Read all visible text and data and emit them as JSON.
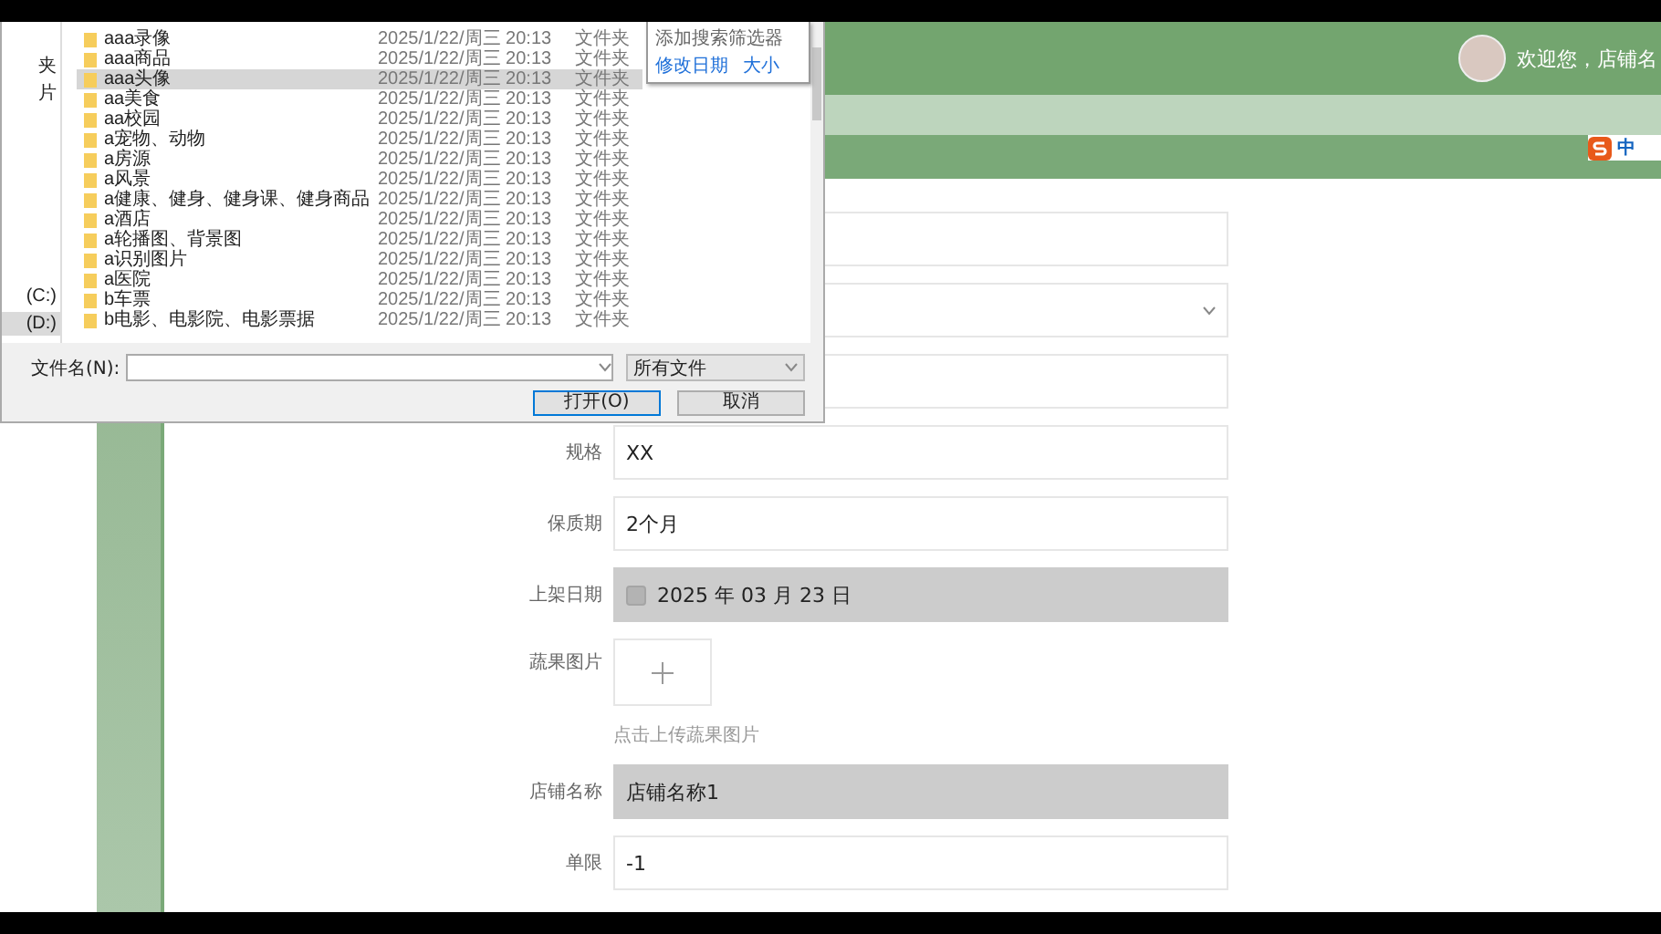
{
  "header": {
    "welcome": "欢迎您，店铺名"
  },
  "ime": {
    "label": "中"
  },
  "form": {
    "rows": [
      {
        "kind": "input",
        "disabled": false
      },
      {
        "kind": "select",
        "disabled": false
      },
      {
        "kind": "input",
        "disabled": false
      },
      {
        "kind": "input",
        "label": "规格",
        "value": "XX",
        "disabled": false
      },
      {
        "kind": "input",
        "label": "保质期",
        "value": "2个月",
        "disabled": false
      },
      {
        "kind": "date",
        "label": "上架日期",
        "value": "2025 年 03 月 23 日",
        "disabled": true
      },
      {
        "kind": "upload",
        "label": "蔬果图片",
        "hint": "点击上传蔬果图片"
      },
      {
        "kind": "input",
        "label": "店铺名称",
        "value": "店铺名称1",
        "disabled": true
      },
      {
        "kind": "input",
        "label": "单限",
        "value": "-1",
        "disabled": false
      }
    ]
  },
  "dialog": {
    "nav": [
      {
        "label": "夹",
        "selected": false
      },
      {
        "label": "片",
        "selected": false
      },
      {
        "label": "(C:)",
        "selected": false
      },
      {
        "label": "(D:)",
        "selected": true
      }
    ],
    "files": [
      {
        "name": "aaa录像",
        "date": "2025/1/22/周三 20:13",
        "type": "文件夹",
        "selected": false
      },
      {
        "name": "aaa商品",
        "date": "2025/1/22/周三 20:13",
        "type": "文件夹",
        "selected": false
      },
      {
        "name": "aaa头像",
        "date": "2025/1/22/周三 20:13",
        "type": "文件夹",
        "selected": true
      },
      {
        "name": "aa美食",
        "date": "2025/1/22/周三 20:13",
        "type": "文件夹",
        "selected": false
      },
      {
        "name": "aa校园",
        "date": "2025/1/22/周三 20:13",
        "type": "文件夹",
        "selected": false
      },
      {
        "name": "a宠物、动物",
        "date": "2025/1/22/周三 20:13",
        "type": "文件夹",
        "selected": false
      },
      {
        "name": "a房源",
        "date": "2025/1/22/周三 20:13",
        "type": "文件夹",
        "selected": false
      },
      {
        "name": "a风景",
        "date": "2025/1/22/周三 20:13",
        "type": "文件夹",
        "selected": false
      },
      {
        "name": "a健康、健身、健身课、健身商品",
        "date": "2025/1/22/周三 20:13",
        "type": "文件夹",
        "selected": false
      },
      {
        "name": "a酒店",
        "date": "2025/1/22/周三 20:13",
        "type": "文件夹",
        "selected": false
      },
      {
        "name": "a轮播图、背景图",
        "date": "2025/1/22/周三 20:13",
        "type": "文件夹",
        "selected": false
      },
      {
        "name": "a识别图片",
        "date": "2025/1/22/周三 20:13",
        "type": "文件夹",
        "selected": false
      },
      {
        "name": "a医院",
        "date": "2025/1/22/周三 20:13",
        "type": "文件夹",
        "selected": false
      },
      {
        "name": "b车票",
        "date": "2025/1/22/周三 20:13",
        "type": "文件夹",
        "selected": false
      },
      {
        "name": "b电影、电影院、电影票据",
        "date": "2025/1/22/周三 20:13",
        "type": "文件夹",
        "selected": false
      }
    ],
    "filter": {
      "title": "添加搜索筛选器",
      "links": [
        "修改日期",
        "大小"
      ]
    },
    "filename_label": "文件名(N):",
    "filetype": "所有文件",
    "buttons": [
      {
        "label": "打开(O)",
        "default": true
      },
      {
        "label": "取消",
        "default": false
      }
    ]
  }
}
